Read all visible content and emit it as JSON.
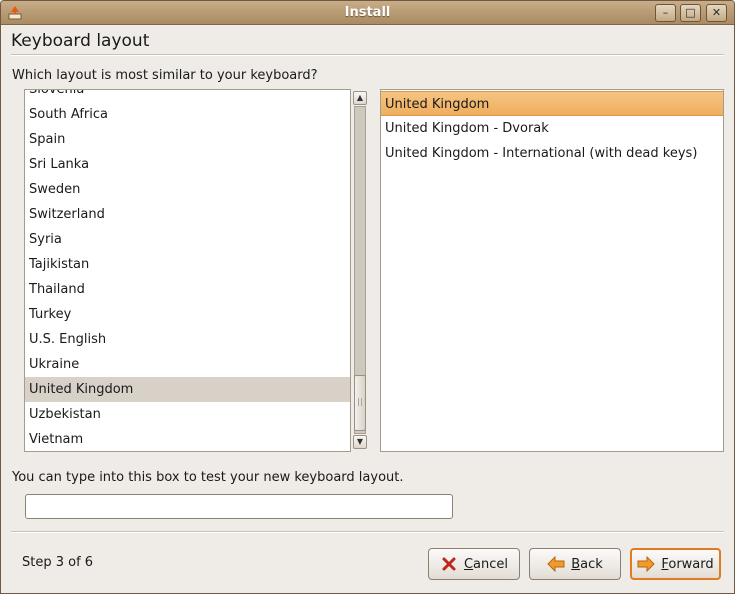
{
  "window": {
    "title": "Install",
    "app_icon": "installer-icon",
    "controls": {
      "minimize": "–",
      "maximize": "□",
      "close": "✕"
    }
  },
  "page": {
    "heading": "Keyboard layout",
    "question": "Which layout is most similar to your keyboard?",
    "test_label": "You can type into this box to test your new keyboard layout.",
    "test_input_value": "",
    "step": "Step 3 of 6"
  },
  "countries": {
    "partial_top": "Slovenia",
    "items": [
      "South Africa",
      "Spain",
      "Sri Lanka",
      "Sweden",
      "Switzerland",
      "Syria",
      "Tajikistan",
      "Thailand",
      "Turkey",
      "U.S. English",
      "Ukraine",
      "United Kingdom",
      "Uzbekistan",
      "Vietnam"
    ],
    "selected": "United Kingdom"
  },
  "variants": {
    "items": [
      "United Kingdom",
      "United Kingdom - Dvorak",
      "United Kingdom - International (with dead keys)"
    ],
    "selected": "United Kingdom"
  },
  "buttons": {
    "cancel": "Cancel",
    "back": "Back",
    "forward": "Forward"
  },
  "colors": {
    "selection_accent": "#efae5d",
    "default_button_border": "#e07b22",
    "titlebar": "#b99a70"
  }
}
